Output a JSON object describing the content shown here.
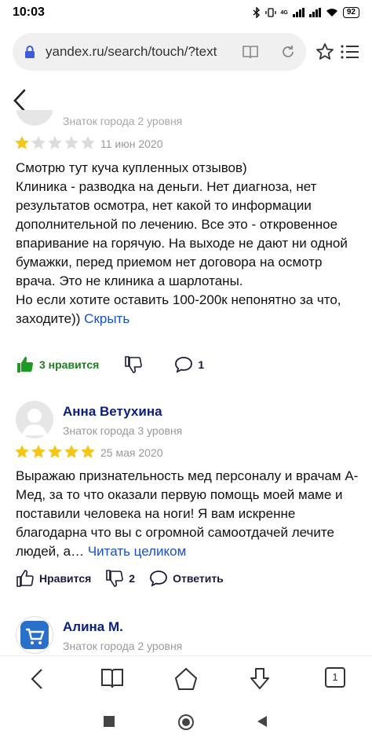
{
  "status": {
    "time": "10:03",
    "network": "4G",
    "battery": "92"
  },
  "browser": {
    "url": "yandex.ru/search/touch/?text",
    "tab_count": "1"
  },
  "reviews": [
    {
      "author": "",
      "level": "Знаток города 2 уровня",
      "rating": 1,
      "date": "11 июн 2020",
      "text": "Смотрю тут куча купленных отзывов)\nКлиника - разводка на деньги. Нет диагноза, нет результатов осмотра, нет какой то информации дополнительной по лечению. Все это - откровенное впаривание на горячую. На выходе не дают ни одной бумажки, перед приемом нет договора на осмотр врача. Это не клиника а шарлотаны.\nНо если хотите оставить 100-200к непонятно за что, заходите))",
      "more_link": "Скрыть",
      "like_label": "3 нравится",
      "comments": "1"
    },
    {
      "author": "Анна Ветухина",
      "level": "Знаток города 3 уровня",
      "rating": 5,
      "date": "25 мая 2020",
      "text": "Выражаю признательность мед персоналу и врачам А-Мед, за то что оказали первую помощь моей маме и поставили человека на ноги! Я вам искренне благодарна что вы с огромной самоотдачей лечите людей, а…",
      "more_link": "Читать целиком",
      "like_label": "Нравится",
      "dislike_count": "2",
      "reply_label": "Ответить"
    },
    {
      "author": "Алина М.",
      "level": "Знаток города 2 уровня"
    }
  ],
  "colors": {
    "star_on": "#f5c518",
    "star_off": "#dcdcdc",
    "link": "#1a4fc9",
    "author": "#0b1f7a",
    "green": "#1d7f1f"
  }
}
